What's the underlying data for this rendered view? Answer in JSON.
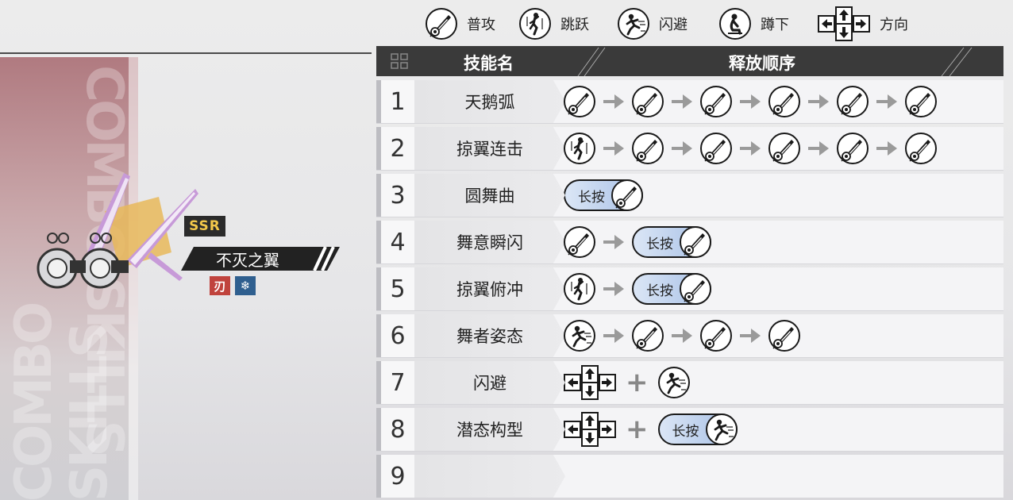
{
  "legend": [
    {
      "icon": "attack-icon",
      "label": "普攻"
    },
    {
      "icon": "jump-icon",
      "label": "跳跃"
    },
    {
      "icon": "dodge-icon",
      "label": "闪避"
    },
    {
      "icon": "crouch-icon",
      "label": "蹲下"
    },
    {
      "icon": "direction-icon",
      "label": "方向"
    }
  ],
  "character": {
    "rarity": "SSR",
    "name": "不灭之翼",
    "background_text": "COMBO SKILLS",
    "elements": [
      "fire-element-icon",
      "ice-element-icon"
    ],
    "element_glyphs": {
      "fire": "刃",
      "ice": "❄"
    }
  },
  "table": {
    "header_name": "技能名",
    "header_sequence": "释放顺序",
    "hold_label": "长按",
    "rows": [
      {
        "num": "1",
        "name": "天鹅弧",
        "sequence": [
          "attack",
          "attack",
          "attack",
          "attack",
          "attack",
          "attack"
        ]
      },
      {
        "num": "2",
        "name": "掠翼连击",
        "sequence": [
          "jump",
          "attack",
          "attack",
          "attack",
          "attack",
          "attack"
        ]
      },
      {
        "num": "3",
        "name": "圆舞曲",
        "sequence": [
          "hold-attack"
        ]
      },
      {
        "num": "4",
        "name": "舞意瞬闪",
        "sequence": [
          "attack",
          "hold-attack"
        ]
      },
      {
        "num": "5",
        "name": "掠翼俯冲",
        "sequence": [
          "jump",
          "hold-attack"
        ]
      },
      {
        "num": "6",
        "name": "舞者姿态",
        "sequence": [
          "dodge",
          "attack",
          "attack",
          "attack"
        ]
      },
      {
        "num": "7",
        "name": "闪避",
        "sequence": [
          "direction",
          "+",
          "dodge"
        ]
      },
      {
        "num": "8",
        "name": "潜态构型",
        "sequence": [
          "direction",
          "+",
          "hold-dodge"
        ]
      },
      {
        "num": "9",
        "name": "",
        "sequence": []
      }
    ]
  },
  "colors": {
    "header_bg": "#3a3a3a",
    "hold_gradient_start": "#dbe6f6",
    "hold_gradient_end": "#a7c0e6",
    "ssr_text": "#f3c84a",
    "fire_element": "#c0433d",
    "ice_element": "#2f5f8f"
  }
}
